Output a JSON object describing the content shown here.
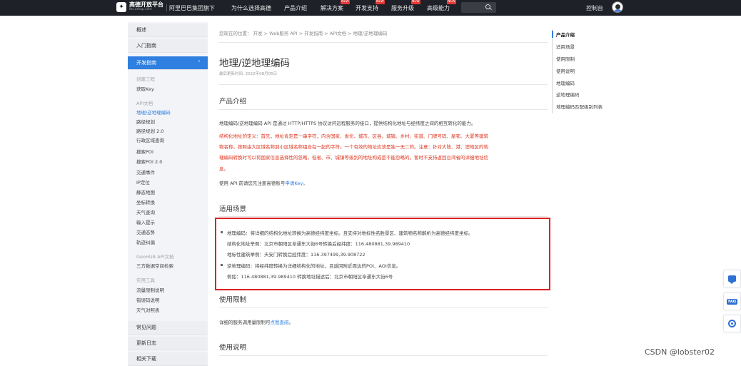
{
  "header": {
    "logo_text": "高德开放平台",
    "logo_sub": "lbs.amap.com",
    "alibaba": "阿里巴巴集团旗下",
    "nav": [
      {
        "label": "为什么选择高德",
        "hot": ""
      },
      {
        "label": "产品介绍",
        "hot": ""
      },
      {
        "label": "解决方案",
        "hot": "NEW"
      },
      {
        "label": "开发支持",
        "hot": "NEW"
      },
      {
        "label": "服务升级",
        "hot": "NEW"
      },
      {
        "label": "高级能力",
        "hot": "NEW"
      }
    ],
    "console": "控制台"
  },
  "sidebar": {
    "overview": "概述",
    "getting_started": "入门指南",
    "dev_guide": "开发指南",
    "group1": "创建工程",
    "get_key": "获取Key",
    "group_api": "API文档",
    "api_items": [
      "地理/逆地理编码",
      "路径规划",
      "路径规划 2.0",
      "行政区域查询",
      "搜索POI",
      "搜索POI 2.0",
      "交通事件",
      "IP定位",
      "静态地图",
      "坐标转换",
      "天气查询",
      "输入提示",
      "交通态势",
      "轨迹纠偏"
    ],
    "group_geohub": "GeoHUB API文档",
    "geohub_item": "三方数据空间检索",
    "group_tools": "实用工具",
    "tools_items": [
      "流量限制说明",
      "错误码说明",
      "天气对照表"
    ],
    "faq": "常见问题",
    "changelog": "更新日志",
    "download": "相关下载"
  },
  "main": {
    "breadcrumb": "您现在的位置： 开发 > Web服务 API > 开发指南 > API文档 > 地理/逆地理编码",
    "title": "地理/逆地理编码",
    "updated": "最后更新时间: 2022年08月05日",
    "sec_intro": "产品介绍",
    "intro_text": "地理编码/逆地理编码 API 是通过 HTTP/HTTPS 协议访问远程服务的接口，提供结构化地址与经纬度之间的相互转化的能力。",
    "red_note_1": "结构化地址的定义：首先，地址肯定是一串字符，内含国家、省份、城市、区县、城镇、乡村、街道、门牌号码、屋邨、大厦等建筑",
    "red_note_2": "物名称。按照由大区域名称到小区域名称组合在一起的字符。一个有效的地址应该是独一无二的。注意：针对大陆、港、澳地区的地",
    "red_note_3": "理编码转换时可以将国家信息选择性的忽略，但省、市、城镇等级别的地址构成是不能忽略的。暂时不支持返回台湾省的详细地址信",
    "red_note_4": "息。",
    "use_prefix": "使用 API 前请您先注册高德账号",
    "use_link": "申请Key",
    "use_suffix": "。",
    "sec_scenario": "适用场景",
    "scenario_1": "地理编码：将详细的结构化地址转换为高德经纬度坐标。且支持对地标性名胜景区、建筑物名称解析为高德经纬度坐标。",
    "scenario_1a": "结构化地址举例：北京市朝阳区阜通东大街6号转换后经纬度：116.480881,39.989410",
    "scenario_1b": "地标性建筑举例：天安门转换后经纬度：116.397499,39.908722",
    "scenario_2": "逆地理编码：将经纬度转换为详细结构化的地址，且返回附近周边的POI、AOI信息。",
    "scenario_2a": "例如：116.480881,39.989410 转换地址描述后：北京市朝阳区阜通东大街6号",
    "sec_limit": "使用限制",
    "limit_prefix": "详细的服务调用量限制可",
    "limit_link": "点我查阅",
    "limit_suffix": "。",
    "sec_usage": "使用说明"
  },
  "toc": [
    "产品介绍",
    "适用场景",
    "使用限制",
    "使用说明",
    "地理编码",
    "逆地理编码",
    "地理编码匹配级别列表"
  ],
  "watermark": "CSDN @lobster02"
}
